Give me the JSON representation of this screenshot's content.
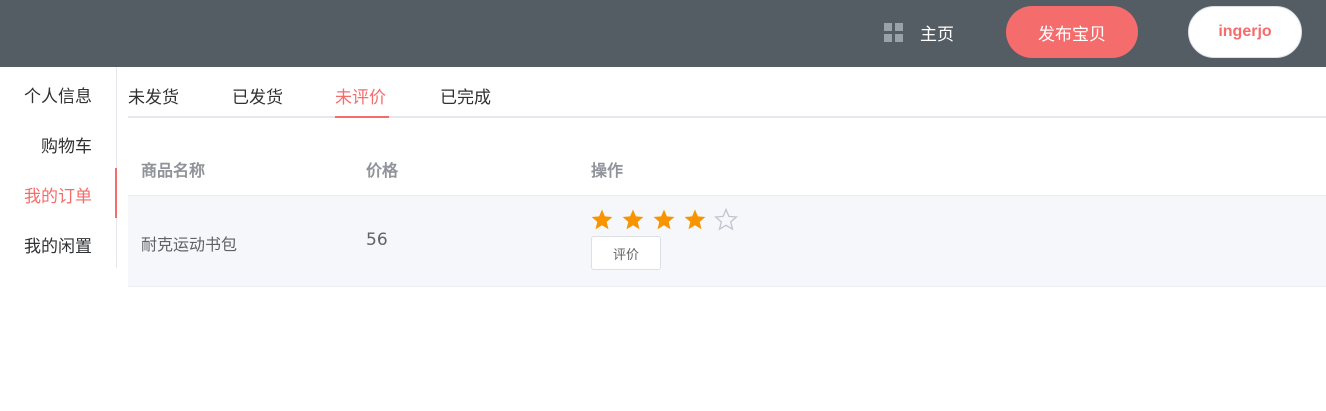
{
  "header": {
    "home_label": "主页",
    "publish_label": "发布宝贝",
    "user_label": "ingerjo"
  },
  "sidebar": {
    "items": [
      {
        "label": "个人信息"
      },
      {
        "label": "购物车"
      },
      {
        "label": "我的订单"
      },
      {
        "label": "我的闲置"
      }
    ],
    "active": "我的订单"
  },
  "tabs": {
    "items": [
      {
        "label": "未发货"
      },
      {
        "label": "已发货"
      },
      {
        "label": "未评价"
      },
      {
        "label": "已完成"
      }
    ],
    "active": "未评价"
  },
  "table": {
    "columns": [
      "商品名称",
      "价格",
      "操作"
    ],
    "rows": [
      {
        "name": "耐克运动书包",
        "price": "56",
        "rating": 4,
        "rating_max": 5,
        "action": "评价"
      }
    ]
  },
  "colors": {
    "topbar": "#545c64",
    "accent": "#f56c6c",
    "star_filled": "#f79400",
    "star_empty": "#c0c4cc"
  }
}
